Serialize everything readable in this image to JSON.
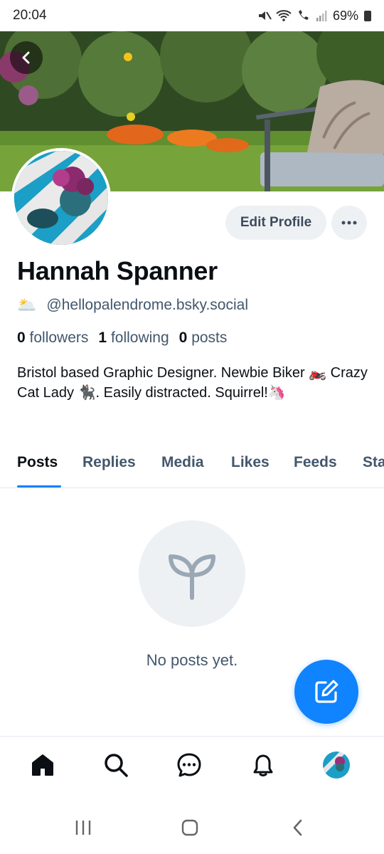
{
  "status_bar": {
    "time": "20:04",
    "battery": "69%",
    "icons": [
      "mute-icon",
      "wifi-icon",
      "wifi-call-icon",
      "signal-icon",
      "battery-icon"
    ]
  },
  "profile": {
    "display_name": "Hannah Spanner",
    "handle_emoji": "🌥️",
    "handle": "@hellopalendrome.bsky.social",
    "followers_count": "0",
    "followers_label": "followers",
    "following_count": "1",
    "following_label": "following",
    "posts_count": "0",
    "posts_label": "posts",
    "bio": "Bristol based Graphic Designer. Newbie Biker 🏍️ Crazy Cat Lady 🐈‍⬛. Easily distracted. Squirrel!🦄"
  },
  "actions": {
    "edit_profile_label": "Edit Profile",
    "more_icon": "more-horizontal-icon",
    "back_icon": "chevron-left-icon"
  },
  "tabs": [
    {
      "label": "Posts",
      "active": true
    },
    {
      "label": "Replies",
      "active": false
    },
    {
      "label": "Media",
      "active": false
    },
    {
      "label": "Likes",
      "active": false
    },
    {
      "label": "Feeds",
      "active": false
    },
    {
      "label": "Starter Packs",
      "active": false
    }
  ],
  "empty_state": {
    "icon": "sprout-icon",
    "text": "No posts yet."
  },
  "compose": {
    "icon": "compose-icon"
  },
  "bottom_nav": [
    {
      "name": "home-icon",
      "active": true
    },
    {
      "name": "search-icon",
      "active": false
    },
    {
      "name": "chat-icon",
      "active": false
    },
    {
      "name": "notifications-icon",
      "active": false
    },
    {
      "name": "profile-avatar",
      "active": false
    }
  ],
  "colors": {
    "accent": "#1083fe",
    "muted_text": "#42576c",
    "button_bg": "#eef1f4"
  }
}
